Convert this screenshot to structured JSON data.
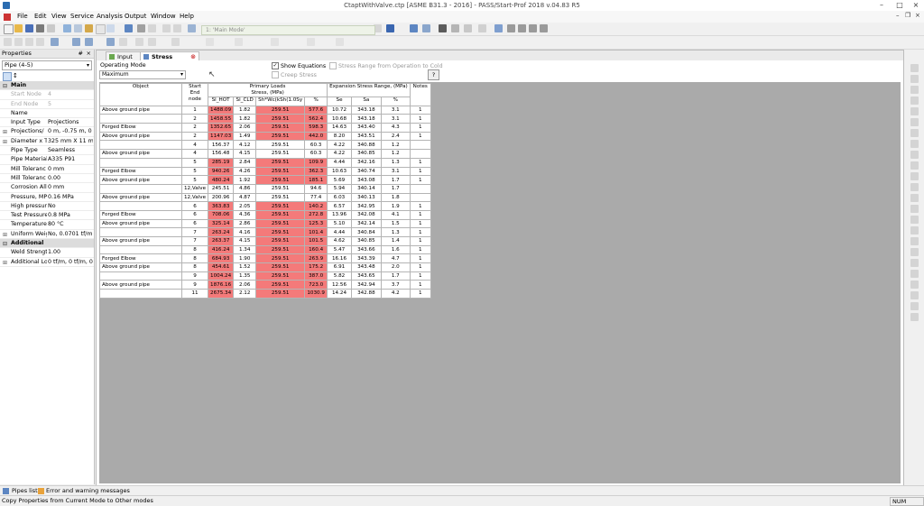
{
  "window": {
    "title": "CtaptWithValve.ctp [ASME B31.3 - 2016] - PASS/Start-Prof 2018 v.04.83 R5"
  },
  "menu": [
    "File",
    "Edit",
    "View",
    "Service",
    "Analysis",
    "Output",
    "Window",
    "Help"
  ],
  "toolbar": {
    "mode_value": "1: 'Main Mode'"
  },
  "properties": {
    "title": "Properties",
    "pin": "# ",
    "close": "×",
    "selector": "Pipe (4-5)",
    "rows": [
      {
        "type": "group",
        "key": "Main"
      },
      {
        "key": "Start Node",
        "value": "4",
        "disabled": true
      },
      {
        "key": "End Node",
        "value": "5",
        "disabled": true
      },
      {
        "key": "Name",
        "value": ""
      },
      {
        "key": "Input Type",
        "value": "Projections"
      },
      {
        "key": "Projections/",
        "value": "0 m, -0.75 m, 0 m",
        "expand": "⊞"
      },
      {
        "key": "Diameter x Th",
        "value": "325 mm X 11 mm",
        "expand": "⊞"
      },
      {
        "key": "Pipe Type",
        "value": "Seamless"
      },
      {
        "key": "Pipe Material",
        "value": "A335 P91"
      },
      {
        "key": "Mill Toleranc",
        "value": "0 mm"
      },
      {
        "key": "Mill Toleranc",
        "value": "0.00"
      },
      {
        "key": "Corrosion All",
        "value": "0 mm"
      },
      {
        "key": "Pressure, MPa",
        "value": "0.16 MPa"
      },
      {
        "key": "High pressure",
        "value": "No"
      },
      {
        "key": "Test Pressure,",
        "value": "0.8 MPa"
      },
      {
        "key": "Temperature,",
        "value": "80 °C"
      },
      {
        "key": "Uniform Weig",
        "value": "No, 0.0701 tf/m,",
        "expand": "⊞"
      },
      {
        "type": "group",
        "key": "Additional"
      },
      {
        "key": "Weld Strengtl",
        "value": "1.00"
      },
      {
        "key": "Additional Lo",
        "value": "0 tf/m, 0 tf/m, 0 t",
        "expand": "⊞"
      }
    ]
  },
  "tabs": [
    {
      "label": "Input"
    },
    {
      "label": "Stress"
    }
  ],
  "options": {
    "mode_label": "Operating Mode",
    "mode_value": "Maximum",
    "show_equations": "Show Equations",
    "creep_stress": "Creep Stress",
    "stress_range": "Stress Range from Operation to Cold",
    "help": "?"
  },
  "table": {
    "headers": {
      "object": "Object",
      "start": "Start\nEnd\nnode",
      "primary": "Primary Loads\nStress, (MPa)",
      "expansion": "Expansion Stress Range, (MPa)",
      "notes": "Notes",
      "sl_hot": "Sl_HOT",
      "sl_cld": "Sl_CLD",
      "sh": "Sh*Wc(kSh(1.0Sy",
      "pct1": "%",
      "se": "Se",
      "sa": "Sa",
      "pct2": "%"
    },
    "rows": [
      {
        "obj": "Above ground pipe",
        "node": "1",
        "hot": "1488.09",
        "cld": "1.82",
        "sh": "259.51",
        "pct": "577.6",
        "se": "10.72",
        "sa": "343.18",
        "p2": "3.1",
        "notes": "1",
        "hl": true
      },
      {
        "obj": "",
        "node": "2",
        "hot": "1458.55",
        "cld": "1.82",
        "sh": "259.51",
        "pct": "562.4",
        "se": "10.68",
        "sa": "343.18",
        "p2": "3.1",
        "notes": "1",
        "hl": true
      },
      {
        "obj": "Forged Elbow",
        "node": "2",
        "hot": "1352.65",
        "cld": "2.06",
        "sh": "259.51",
        "pct": "598.3",
        "se": "14.63",
        "sa": "343.40",
        "p2": "4.3",
        "notes": "1",
        "hl": true
      },
      {
        "obj": "Above ground pipe",
        "node": "2",
        "hot": "1147.03",
        "cld": "1.49",
        "sh": "259.51",
        "pct": "442.0",
        "se": "8.20",
        "sa": "343.51",
        "p2": "2.4",
        "notes": "1",
        "hl": true
      },
      {
        "obj": "",
        "node": "4",
        "hot": "156.37",
        "cld": "4.12",
        "sh": "259.51",
        "pct": "60.3",
        "se": "4.22",
        "sa": "340.88",
        "p2": "1.2",
        "notes": "",
        "hl": false
      },
      {
        "obj": "Above ground pipe",
        "node": "4",
        "hot": "156.48",
        "cld": "4.15",
        "sh": "259.51",
        "pct": "60.3",
        "se": "4.22",
        "sa": "340.85",
        "p2": "1.2",
        "notes": "",
        "hl": false
      },
      {
        "obj": "",
        "node": "5",
        "hot": "285.19",
        "cld": "2.84",
        "sh": "259.51",
        "pct": "109.9",
        "se": "4.44",
        "sa": "342.16",
        "p2": "1.3",
        "notes": "1",
        "hl": true
      },
      {
        "obj": "Forged Elbow",
        "node": "5",
        "hot": "940.26",
        "cld": "4.26",
        "sh": "259.51",
        "pct": "362.3",
        "se": "10.63",
        "sa": "340.74",
        "p2": "3.1",
        "notes": "1",
        "hl": true
      },
      {
        "obj": "Above ground pipe",
        "node": "5",
        "hot": "480.24",
        "cld": "1.92",
        "sh": "259.51",
        "pct": "185.1",
        "se": "5.69",
        "sa": "343.08",
        "p2": "1.7",
        "notes": "1",
        "hl": true
      },
      {
        "obj": "",
        "node": "12,Valve",
        "hot": "245.51",
        "cld": "4.86",
        "sh": "259.51",
        "pct": "94.6",
        "se": "5.94",
        "sa": "340.14",
        "p2": "1.7",
        "notes": "",
        "hl": false
      },
      {
        "obj": "Above ground pipe",
        "node": "12,Valve",
        "hot": "200.96",
        "cld": "4.87",
        "sh": "259.51",
        "pct": "77.4",
        "se": "6.03",
        "sa": "340.13",
        "p2": "1.8",
        "notes": "",
        "hl": false
      },
      {
        "obj": "",
        "node": "6",
        "hot": "363.83",
        "cld": "2.05",
        "sh": "259.51",
        "pct": "140.2",
        "se": "6.57",
        "sa": "342.95",
        "p2": "1.9",
        "notes": "1",
        "hl": true
      },
      {
        "obj": "Forged Elbow",
        "node": "6",
        "hot": "708.06",
        "cld": "4.36",
        "sh": "259.51",
        "pct": "272.8",
        "se": "13.96",
        "sa": "342.08",
        "p2": "4.1",
        "notes": "1",
        "hl": true
      },
      {
        "obj": "Above ground pipe",
        "node": "6",
        "hot": "325.14",
        "cld": "2.86",
        "sh": "259.51",
        "pct": "125.3",
        "se": "5.10",
        "sa": "342.14",
        "p2": "1.5",
        "notes": "1",
        "hl": true
      },
      {
        "obj": "",
        "node": "7",
        "hot": "263.24",
        "cld": "4.16",
        "sh": "259.51",
        "pct": "101.4",
        "se": "4.44",
        "sa": "340.84",
        "p2": "1.3",
        "notes": "1",
        "hl": true
      },
      {
        "obj": "Above ground pipe",
        "node": "7",
        "hot": "263.37",
        "cld": "4.15",
        "sh": "259.51",
        "pct": "101.5",
        "se": "4.62",
        "sa": "340.85",
        "p2": "1.4",
        "notes": "1",
        "hl": true
      },
      {
        "obj": "",
        "node": "8",
        "hot": "416.24",
        "cld": "1.34",
        "sh": "259.51",
        "pct": "160.4",
        "se": "5.47",
        "sa": "343.66",
        "p2": "1.6",
        "notes": "1",
        "hl": true
      },
      {
        "obj": "Forged Elbow",
        "node": "8",
        "hot": "684.93",
        "cld": "1.90",
        "sh": "259.51",
        "pct": "263.9",
        "se": "16.16",
        "sa": "343.39",
        "p2": "4.7",
        "notes": "1",
        "hl": true
      },
      {
        "obj": "Above ground pipe",
        "node": "8",
        "hot": "454.61",
        "cld": "1.52",
        "sh": "259.51",
        "pct": "175.2",
        "se": "6.91",
        "sa": "343.48",
        "p2": "2.0",
        "notes": "1",
        "hl": true
      },
      {
        "obj": "",
        "node": "9",
        "hot": "1004.24",
        "cld": "1.35",
        "sh": "259.51",
        "pct": "387.0",
        "se": "5.82",
        "sa": "343.65",
        "p2": "1.7",
        "notes": "1",
        "hl": true
      },
      {
        "obj": "Above ground pipe",
        "node": "9",
        "hot": "1876.16",
        "cld": "2.06",
        "sh": "259.51",
        "pct": "723.0",
        "se": "12.56",
        "sa": "342.94",
        "p2": "3.7",
        "notes": "1",
        "hl": true
      },
      {
        "obj": "",
        "node": "11",
        "hot": "2675.34",
        "cld": "2.12",
        "sh": "259.51",
        "pct": "1030.9",
        "se": "14.24",
        "sa": "342.88",
        "p2": "4.2",
        "notes": "1",
        "hl": true
      }
    ]
  },
  "bottom_tabs": {
    "pipes_list": "Pipes list",
    "messages": "Error and warning messages"
  },
  "status": {
    "text": "Copy Properties from Current Mode to Other modes",
    "num": "NUM"
  },
  "colors": {
    "highlight": "#f47a7a",
    "grey_area": "#aaaaaa"
  }
}
